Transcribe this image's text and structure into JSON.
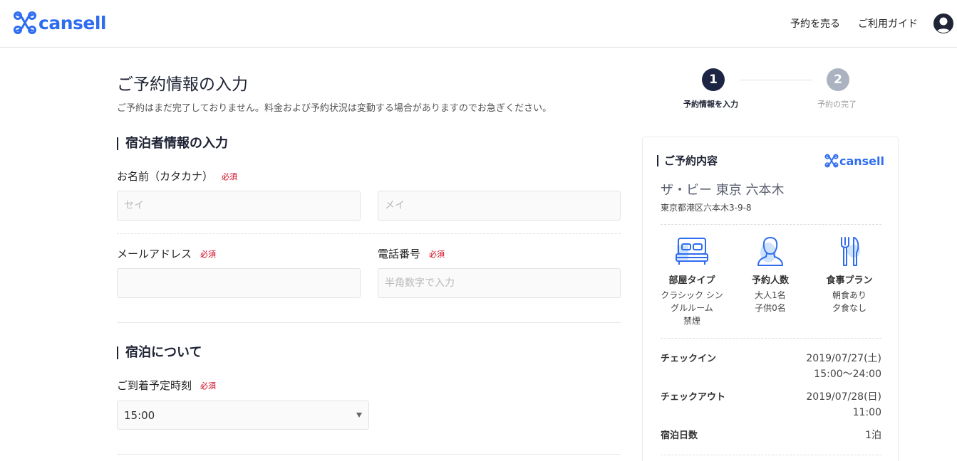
{
  "header": {
    "logo_text": "cansell",
    "nav": [
      {
        "label": "予約を売る"
      },
      {
        "label": "ご利用ガイド"
      }
    ]
  },
  "page": {
    "title": "ご予約情報の入力",
    "note": "ご予約はまだ完了しておりません。料金および予約状況は変動する場合がありますのでお急ぎください。"
  },
  "guest_section": {
    "title": "宿泊者情報の入力",
    "required_label": "必須",
    "name_label": "お名前（カタカナ）",
    "sei_placeholder": "セイ",
    "mei_placeholder": "メイ",
    "email_label": "メールアドレス",
    "email_value": "",
    "phone_label": "電話番号",
    "phone_placeholder": "半角数字で入力"
  },
  "stay_section": {
    "title": "宿泊について",
    "arrival_label": "ご到着予定時刻",
    "arrival_value": "15:00"
  },
  "steps": [
    {
      "number": "1",
      "label": "予約情報を入力",
      "active": true
    },
    {
      "number": "2",
      "label": "予約の完了",
      "active": false
    }
  ],
  "summary": {
    "title": "ご予約内容",
    "logo_text": "cansell",
    "hotel_name": "ザ・ビー 東京 六本木",
    "hotel_address": "東京都港区六本木3-9-8",
    "features": [
      {
        "icon": "bed-icon",
        "label": "部屋タイプ",
        "lines": [
          "クラシック シン",
          "グルルーム",
          "禁煙"
        ]
      },
      {
        "icon": "person-icon",
        "label": "予約人数",
        "lines": [
          "大人1名",
          "子供0名"
        ]
      },
      {
        "icon": "fork-knife-icon",
        "label": "食事プラン",
        "lines": [
          "朝食あり",
          "夕食なし"
        ]
      }
    ],
    "checkin_label": "チェックイン",
    "checkin_date": "2019/07/27(土)",
    "checkin_time": "15:00〜24:00",
    "checkout_label": "チェックアウト",
    "checkout_date": "2019/07/28(日)",
    "checkout_time": "11:00",
    "nights_label": "宿泊日数",
    "nights_value": "1泊"
  },
  "colors": {
    "brand": "#2e6cf0",
    "navy": "#1d2545",
    "required": "#d0021b"
  }
}
